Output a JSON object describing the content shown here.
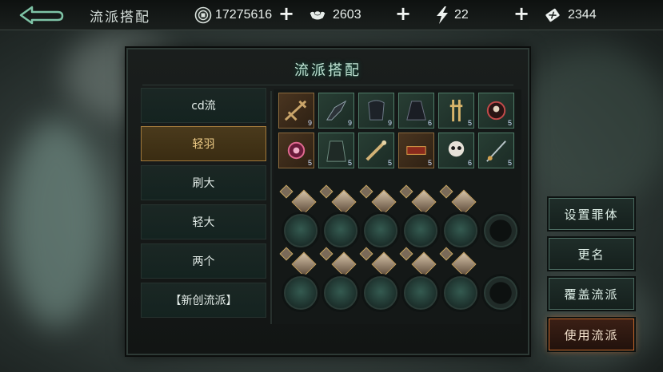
{
  "header": {
    "title": "流派搭配",
    "back_icon": "back-arrow-icon"
  },
  "resources": [
    {
      "name": "coin",
      "icon": "coin-icon",
      "value": "17275616",
      "plus": "+"
    },
    {
      "name": "ingot",
      "icon": "ingot-icon",
      "value": "2603",
      "plus": "+"
    },
    {
      "name": "energy",
      "icon": "lightning-icon",
      "value": "22",
      "plus": "+"
    },
    {
      "name": "ticket",
      "icon": "ticket-icon",
      "value": "2344"
    }
  ],
  "panel": {
    "title": "流派搭配"
  },
  "builds": [
    {
      "label": "cd流",
      "active": false
    },
    {
      "label": "轻羽",
      "active": true
    },
    {
      "label": "刷大",
      "active": false
    },
    {
      "label": "轻大",
      "active": false
    },
    {
      "label": "两个",
      "active": false
    },
    {
      "label": "【新创流派】",
      "active": false
    }
  ],
  "equipment_row1": [
    {
      "icon": "crossbow-icon",
      "badge": "9",
      "style": "orange"
    },
    {
      "icon": "claw-gauntlet-icon",
      "badge": "9",
      "style": "green"
    },
    {
      "icon": "dark-armor-icon",
      "badge": "9",
      "style": "green"
    },
    {
      "icon": "cloak-icon",
      "badge": "6",
      "style": "green"
    },
    {
      "icon": "bone-ornament-icon",
      "badge": "5",
      "style": "green"
    },
    {
      "icon": "charm-orb-icon",
      "badge": "5",
      "style": "green"
    }
  ],
  "equipment_row2": [
    {
      "icon": "red-amulet-icon",
      "badge": "5",
      "style": "orange"
    },
    {
      "icon": "robe-icon",
      "badge": "5",
      "style": "green"
    },
    {
      "icon": "sword-hilt-icon",
      "badge": "5",
      "style": "green"
    },
    {
      "icon": "scroll-box-icon",
      "badge": "5",
      "style": "orange"
    },
    {
      "icon": "skull-mask-icon",
      "badge": "6",
      "style": "green"
    },
    {
      "icon": "hairpin-icon",
      "badge": "5",
      "style": "green"
    }
  ],
  "actions": {
    "set_body": "设置罪体",
    "rename": "更名",
    "overwrite": "覆盖流派",
    "use": "使用流派"
  }
}
